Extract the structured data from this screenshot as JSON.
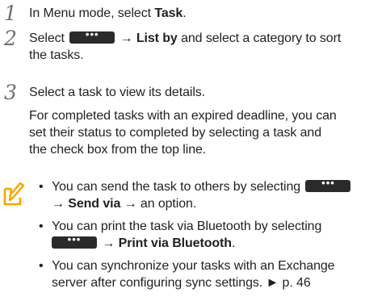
{
  "steps": [
    {
      "number": "1",
      "text_before": "In Menu mode, select ",
      "bold": "Task",
      "text_after": "."
    },
    {
      "number": "2",
      "prefix": "Select",
      "arrow": "→",
      "bold": "List by",
      "text_after": " and select a category to sort",
      "line2": "the tasks."
    },
    {
      "number": "3",
      "line1": "Select a task to view its details.",
      "para": [
        "For completed tasks with an expired deadline, you can",
        "set their status to completed by selecting a task and",
        "the check box from the top line."
      ]
    }
  ],
  "menu_button_glyph": "•••",
  "note": {
    "icon": "note-pencil-icon",
    "bullet_glyph": "•",
    "bullets": [
      {
        "line1": "You can send the task to others by selecting",
        "arrow1": "→",
        "bold": "Send via",
        "arrow2": "→",
        "tail": " an option."
      },
      {
        "line1": "You can print the task via Bluetooth by selecting",
        "arrow": "→",
        "bold": "Print via Bluetooth",
        "tail": "."
      },
      {
        "line1": "You can synchronize your tasks with an Exchange",
        "line2": "server after configuring sync settings. ► p. 46"
      }
    ]
  },
  "colors": {
    "text": "#231f20",
    "step_number": "#6d6e71",
    "icon_accent": "#f7a600",
    "menu_button": "#2a2a2a"
  }
}
